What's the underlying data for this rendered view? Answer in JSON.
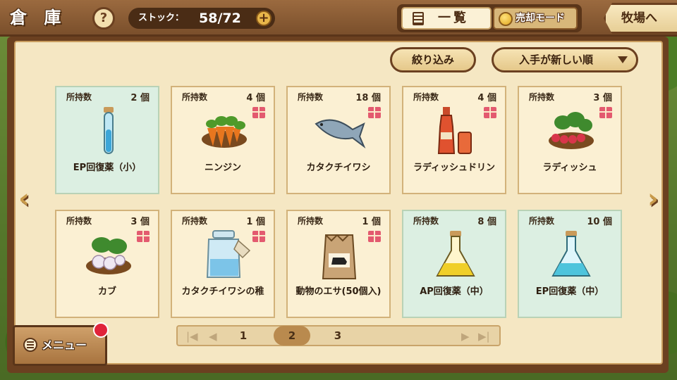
{
  "header": {
    "title": "倉 庫",
    "help_label": "?",
    "stock_label": "ストック：",
    "stock_value": "58/72",
    "stock_add": "+",
    "tab_list_label": "一覧",
    "tab_sell_label": "売却モード",
    "ranch_label": "牧場へ"
  },
  "controls": {
    "filter_label": "絞り込み",
    "sort_label": "入手が新しい順"
  },
  "count_label": "所持数",
  "items": [
    {
      "name": "EP回復薬（小）",
      "count": "2 個",
      "gift": false,
      "tinted": true,
      "icon": "small-potion-blue-icon"
    },
    {
      "name": "ニンジン",
      "count": "4 個",
      "gift": true,
      "tinted": false,
      "icon": "carrot-basket-icon"
    },
    {
      "name": "カタクチイワシ",
      "count": "18 個",
      "gift": true,
      "tinted": false,
      "icon": "anchovy-fish-icon"
    },
    {
      "name": "ラディッシュドリン",
      "count": "4 個",
      "gift": true,
      "tinted": false,
      "icon": "radish-drink-icon"
    },
    {
      "name": "ラディッシュ",
      "count": "3 個",
      "gift": true,
      "tinted": false,
      "icon": "radish-basket-icon"
    },
    {
      "name": "カブ",
      "count": "3 個",
      "gift": true,
      "tinted": false,
      "icon": "turnip-basket-icon"
    },
    {
      "name": "カタクチイワシの稚",
      "count": "1 個",
      "gift": true,
      "tinted": false,
      "icon": "fish-jar-icon"
    },
    {
      "name": "動物のエサ(50個入)",
      "count": "1 個",
      "gift": true,
      "tinted": false,
      "icon": "animal-feed-bag-icon"
    },
    {
      "name": "AP回復薬（中）",
      "count": "8 個",
      "gift": false,
      "tinted": true,
      "icon": "flask-yellow-icon"
    },
    {
      "name": "EP回復薬（中）",
      "count": "10 個",
      "gift": false,
      "tinted": true,
      "icon": "flask-blue-icon"
    }
  ],
  "pager": {
    "pages": [
      "1",
      "2",
      "3"
    ],
    "current": "2"
  },
  "menu": {
    "label": "メニュー"
  },
  "colors": {
    "board": "#6b4020",
    "paper": "#f5e7c3",
    "card": "#fbf0d3",
    "card_tinted": "#dcefe2",
    "gift": "#e35a6f",
    "notification": "#e0233a"
  }
}
